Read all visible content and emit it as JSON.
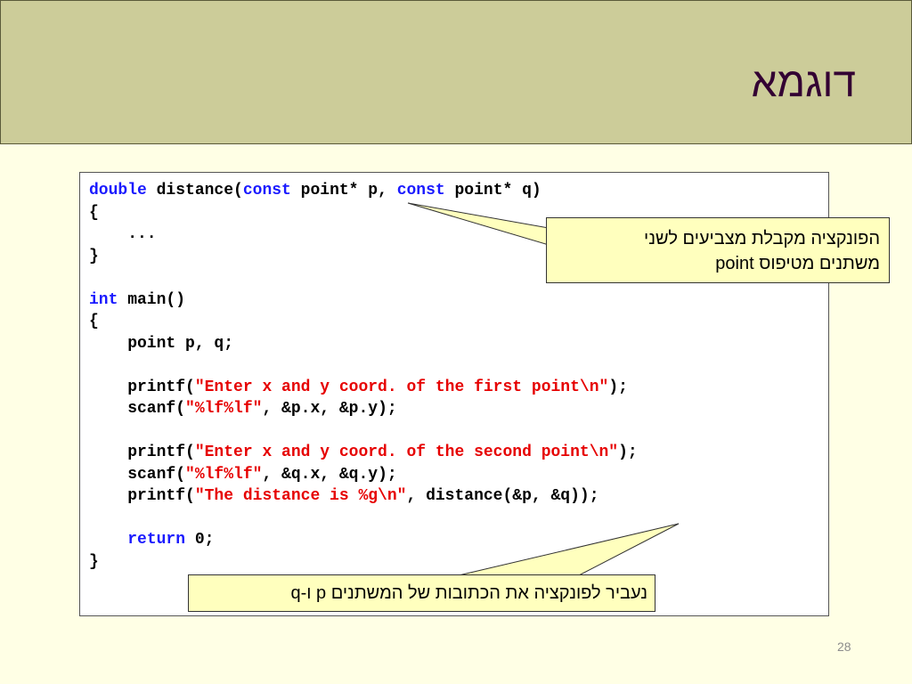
{
  "slide": {
    "title": "דוגמא",
    "page_number": "28"
  },
  "code": {
    "lines": [
      [
        {
          "t": "double",
          "c": "kw"
        },
        {
          "t": " distance("
        },
        {
          "t": "const",
          "c": "kw"
        },
        {
          "t": " point* p, "
        },
        {
          "t": "const",
          "c": "kw"
        },
        {
          "t": " point* q)"
        }
      ],
      [
        {
          "t": "{"
        }
      ],
      [
        {
          "t": "    ..."
        }
      ],
      [
        {
          "t": "}"
        }
      ],
      [],
      [
        {
          "t": "int",
          "c": "kw"
        },
        {
          "t": " main()"
        }
      ],
      [
        {
          "t": "{"
        }
      ],
      [
        {
          "t": "    point p, q;"
        }
      ],
      [],
      [
        {
          "t": "    printf("
        },
        {
          "t": "\"Enter x and y coord. of the first point\\n\"",
          "c": "str"
        },
        {
          "t": ");"
        }
      ],
      [
        {
          "t": "    scanf("
        },
        {
          "t": "\"%lf%lf\"",
          "c": "str"
        },
        {
          "t": ", &p.x, &p.y);"
        }
      ],
      [],
      [
        {
          "t": "    printf("
        },
        {
          "t": "\"Enter x and y coord. of the second point\\n\"",
          "c": "str"
        },
        {
          "t": ");"
        }
      ],
      [
        {
          "t": "    scanf("
        },
        {
          "t": "\"%lf%lf\"",
          "c": "str"
        },
        {
          "t": ", &q.x, &q.y);"
        }
      ],
      [
        {
          "t": "    printf("
        },
        {
          "t": "\"The distance is %g\\n\"",
          "c": "str"
        },
        {
          "t": ", distance(&p, &q));"
        }
      ],
      [],
      [
        {
          "t": "    "
        },
        {
          "t": "return",
          "c": "kw"
        },
        {
          "t": " 0;"
        }
      ],
      [
        {
          "t": "}"
        }
      ]
    ]
  },
  "callouts": {
    "pointer_params": {
      "line1": "הפונקציה מקבלת מצביעים לשני",
      "line2": "משתנים מטיפוס point"
    },
    "address_pass": {
      "text": "נעביר לפונקציה את הכתובות של המשתנים p ו-q"
    }
  },
  "colors": {
    "title_bar": "#cccc99",
    "background": "#ffffe5",
    "title_text": "#330033",
    "keyword": "#1a1aff",
    "string": "#e60000",
    "callout_fill": "#ffffbe"
  }
}
